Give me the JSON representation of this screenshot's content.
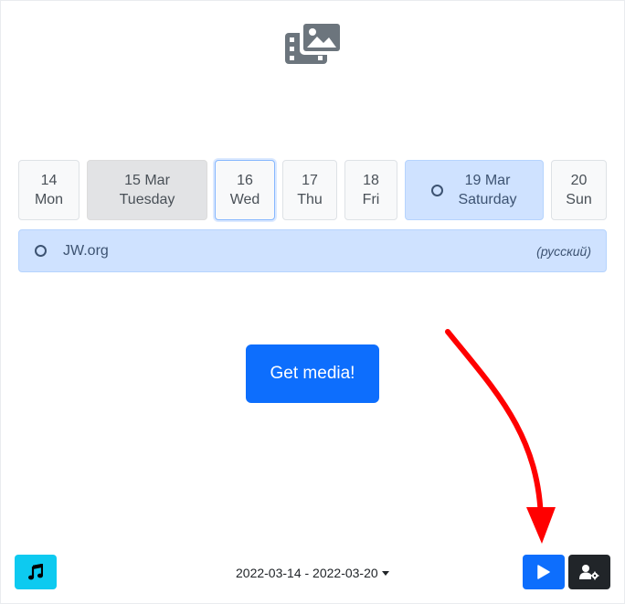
{
  "header": {
    "logo_icon": "media-images-icon"
  },
  "days": [
    {
      "day": "14",
      "name": "Mon"
    },
    {
      "day": "15 Mar",
      "name": "Tuesday"
    },
    {
      "day": "16",
      "name": "Wed"
    },
    {
      "day": "17",
      "name": "Thu"
    },
    {
      "day": "18",
      "name": "Fri"
    },
    {
      "day": "19 Mar",
      "name": "Saturday"
    },
    {
      "day": "20",
      "name": "Sun"
    }
  ],
  "source": {
    "label": "JW.org",
    "language": "(русский)"
  },
  "main": {
    "get_media_label": "Get media!"
  },
  "footer": {
    "music_icon": "music-note-icon",
    "date_range": "2022-03-14 - 2022-03-20",
    "play_icon": "play-icon",
    "settings_icon": "user-gear-icon"
  },
  "colors": {
    "primary": "#0d6efd",
    "info": "#0dcaf0",
    "dark": "#212529",
    "meeting_bg": "#cfe2ff",
    "annotation_arrow": "#ff0000"
  }
}
